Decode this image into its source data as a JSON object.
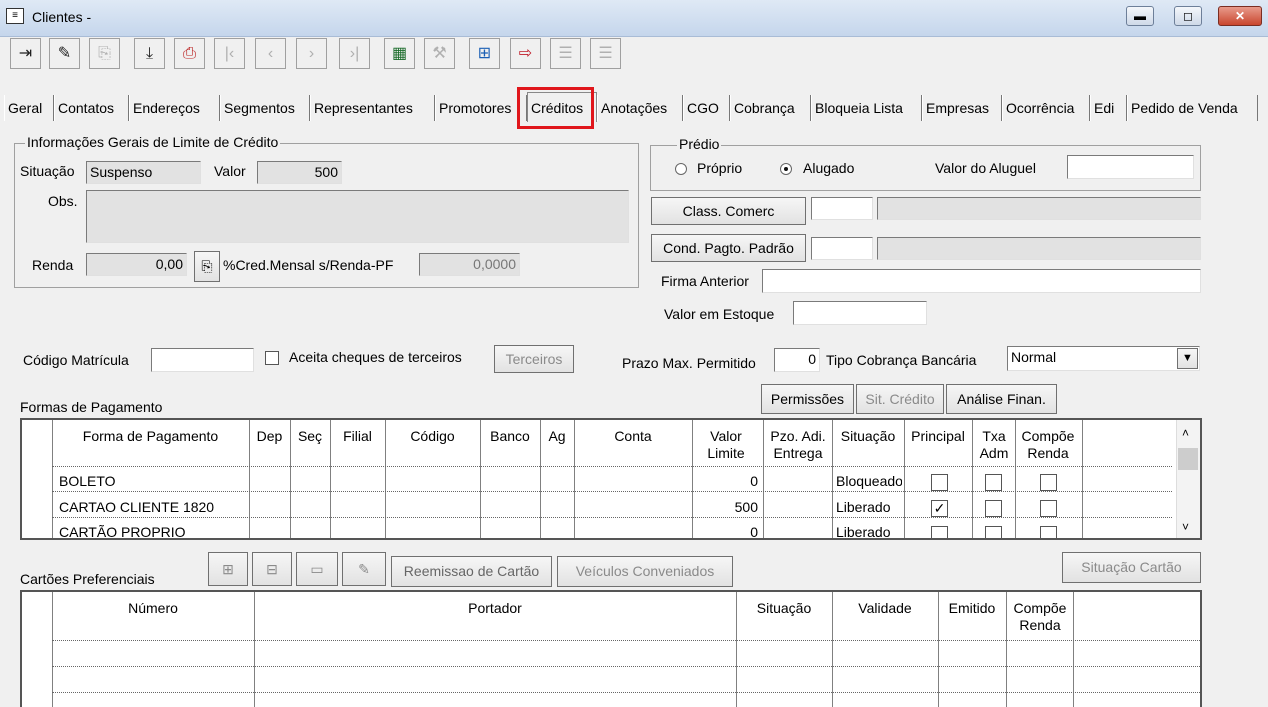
{
  "window": {
    "title": "Clientes -",
    "min_label": "▬",
    "max_label": "◻",
    "close_label": "✕"
  },
  "toolbar": {
    "icons": [
      "exit-icon",
      "edit-icon",
      "copy-icon",
      "save-icon",
      "print-icon",
      "first-icon",
      "prev-icon",
      "next-icon",
      "last-icon",
      "list-icon",
      "tools-icon",
      "add-icon",
      "import-icon",
      "report-icon",
      "report2-icon"
    ]
  },
  "tabs": [
    "Geral",
    "Contatos",
    "Endereços",
    "Segmentos",
    "Representantes",
    "Promotores",
    "Créditos",
    "Anotações",
    "CGO",
    "Cobrança",
    "Bloqueia Lista",
    "Empresas",
    "Ocorrência",
    "Edi",
    "Pedido de Venda"
  ],
  "active_tab": "Créditos",
  "credit_info": {
    "group_title": "Informações Gerais de Limite de Crédito",
    "situacao_label": "Situação",
    "situacao_value": "Suspenso",
    "valor_label": "Valor",
    "valor_value": "500",
    "obs_label": "Obs.",
    "obs_value": "",
    "renda_label": "Renda",
    "renda_value": "0,00",
    "perc_label": "%Cred.Mensal s/Renda-PF",
    "perc_value": "0,0000"
  },
  "predio": {
    "group_title": "Prédio",
    "proprio_label": "Próprio",
    "alugado_label": "Alugado",
    "selected": "Alugado",
    "aluguel_label": "Valor do Aluguel",
    "aluguel_value": ""
  },
  "right_fields": {
    "class_comerc_button": "Class. Comerc",
    "class_code": "",
    "class_desc": "",
    "cond_pagto_button": "Cond. Pagto. Padrão",
    "cond_code": "",
    "cond_desc": "",
    "firma_label": "Firma Anterior",
    "firma_value": "",
    "estoque_label": "Valor em Estoque",
    "estoque_value": ""
  },
  "misc": {
    "matricula_label": "Código Matrícula",
    "matricula_value": "",
    "cheques_label": "Aceita cheques de terceiros",
    "terceiros_button": "Terceiros",
    "prazo_label": "Prazo Max. Permitido",
    "prazo_value": "0",
    "tipo_cob_label": "Tipo Cobrança Bancária",
    "tipo_cob_value": "Normal"
  },
  "action_buttons": {
    "permissoes": "Permissões",
    "sit_credito": "Sit. Crédito",
    "analise": "Análise Finan."
  },
  "formas": {
    "section_label": "Formas de Pagamento",
    "headers": [
      "Forma de Pagamento",
      "Dep",
      "Seç",
      "Filial",
      "Código",
      "Banco",
      "Ag",
      "Conta",
      "Valor Limite",
      "Pzo. Adi. Entrega",
      "Situação",
      "Principal",
      "Txa Adm",
      "Compõe Renda"
    ],
    "rows": [
      {
        "forma": "BOLETO",
        "valor": "0",
        "situacao": "Bloqueado",
        "principal": false
      },
      {
        "forma": "CARTAO CLIENTE 1820",
        "valor": "500",
        "situacao": "Liberado",
        "principal": true
      },
      {
        "forma": "CARTÃO PROPRIO",
        "valor": "0",
        "situacao": "Liberado",
        "principal": false
      }
    ]
  },
  "cartoes": {
    "section_label": "Cartões Preferenciais",
    "reemissao_button": "Reemissao de Cartão",
    "veiculos_button": "Veículos Conveniados",
    "situacao_button": "Situação Cartão",
    "headers": [
      "Número",
      "Portador",
      "Situação",
      "Validade",
      "Emitido",
      "Compõe Renda"
    ]
  },
  "colors": {
    "highlight": "#e0161b",
    "titlebar": "#c5d6ec"
  }
}
